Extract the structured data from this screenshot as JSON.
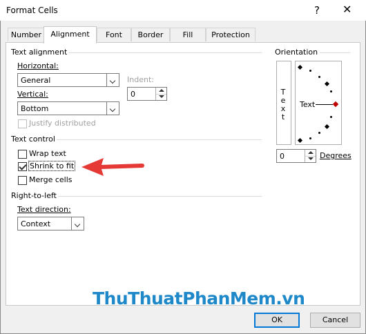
{
  "window": {
    "title": "Format Cells",
    "help_glyph": "?",
    "close_glyph": "✕"
  },
  "tabs": [
    {
      "label": "Number"
    },
    {
      "label": "Alignment",
      "active": true
    },
    {
      "label": "Font"
    },
    {
      "label": "Border"
    },
    {
      "label": "Fill"
    },
    {
      "label": "Protection"
    }
  ],
  "text_alignment": {
    "group_label": "Text alignment",
    "horizontal_label": "Horizontal:",
    "horizontal_value": "General",
    "vertical_label": "Vertical:",
    "vertical_value": "Bottom",
    "indent_label": "Indent:",
    "indent_value": "0",
    "justify_label": "Justify distributed"
  },
  "text_control": {
    "group_label": "Text control",
    "wrap_label": "Wrap text",
    "wrap_checked": false,
    "shrink_label": "Shrink to fit",
    "shrink_checked": true,
    "merge_label": "Merge cells",
    "merge_checked": false
  },
  "rtl": {
    "group_label": "Right-to-left",
    "direction_label": "Text direction:",
    "direction_value": "Context"
  },
  "orientation": {
    "group_label": "Orientation",
    "vertical_text": "Text",
    "text_label": "Text",
    "degrees_value": "0",
    "degrees_label": "Degrees"
  },
  "watermark": {
    "text": "ThuThuatPhanMem.vn"
  },
  "buttons": {
    "ok": "OK",
    "cancel": "Cancel"
  },
  "colors": {
    "arrow": "#e53935",
    "diamond_active": "#c00000",
    "default_button": "#0078d7"
  }
}
